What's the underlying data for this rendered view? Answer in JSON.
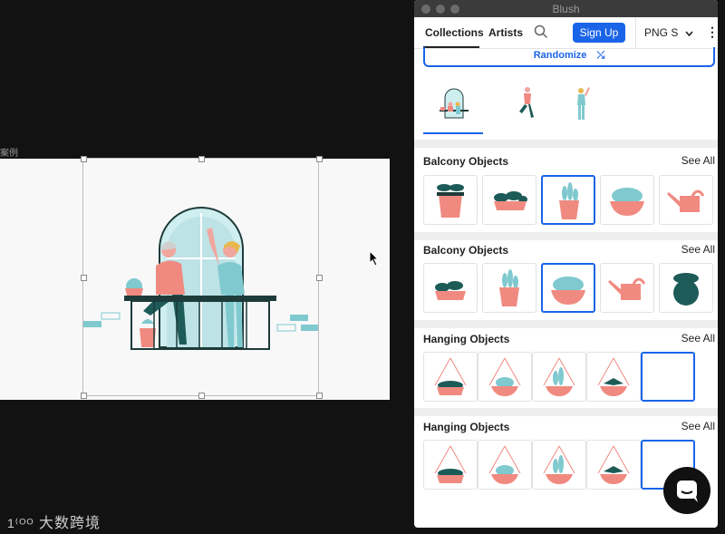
{
  "canvas": {
    "frame_label": "案例",
    "watermark": "大数跨境"
  },
  "window": {
    "title": "Blush"
  },
  "nav": {
    "tabs": [
      "Collections",
      "Artists"
    ],
    "signup_label": "Sign Up",
    "format_value": "PNG S",
    "search_icon": "search-icon",
    "more_icon": "more-vertical-icon"
  },
  "randomize": {
    "label": "Randomize"
  },
  "sections": [
    {
      "title": "Balcony Objects",
      "see_all": "See All",
      "tiles": [
        "pot-plant",
        "trough-plant",
        "pot-succulent",
        "bowl-plant",
        "watering-can"
      ],
      "selected": 2
    },
    {
      "title": "Balcony Objects",
      "see_all": "See All",
      "tiles": [
        "trough-plant",
        "pot-succulent",
        "bowl-plant",
        "watering-can",
        "round-pot-plant"
      ],
      "selected": 2
    },
    {
      "title": "Hanging Objects",
      "see_all": "See All",
      "tiles": [
        "hanging-trough",
        "hanging-bowl",
        "hanging-succulent",
        "hanging-fern",
        "empty"
      ],
      "selected": 4
    },
    {
      "title": "Hanging Objects",
      "see_all": "See All",
      "tiles": [
        "hanging-trough",
        "hanging-bowl",
        "hanging-succulent",
        "hanging-fern",
        "empty"
      ],
      "selected": 4
    }
  ],
  "colors": {
    "accent": "#1a64e8",
    "pink": "#f08a80",
    "teal": "#7fc9cf",
    "dark_green": "#1d5b58"
  }
}
